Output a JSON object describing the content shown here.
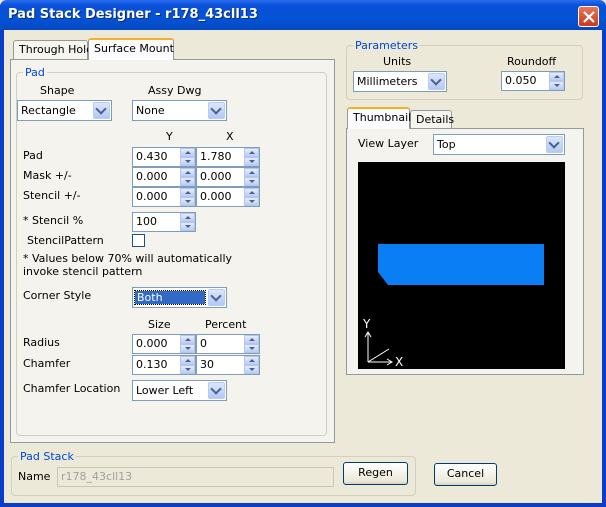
{
  "window": {
    "title": "Pad Stack Designer - r178_43cll13"
  },
  "tabs": [
    {
      "label": "Through Hole"
    },
    {
      "label": "Surface Mount"
    }
  ],
  "pad_group": {
    "legend": "Pad",
    "shape_label": "Shape",
    "shape_value": "Rectangle",
    "assy_label": "Assy Dwg",
    "assy_value": "None",
    "col_y": "Y",
    "col_x": "X",
    "rows": [
      {
        "label": "Pad",
        "y": "0.430",
        "x": "1.780"
      },
      {
        "label": "Mask +/-",
        "y": "0.000",
        "x": "0.000"
      },
      {
        "label": "Stencil +/-",
        "y": "0.000",
        "x": "0.000"
      }
    ],
    "stencil_pct_label": "* Stencil %",
    "stencil_pct_value": "100",
    "stencil_pattern_label": "StencilPattern",
    "note_line1": "* Values below 70% will automatically",
    "note_line2": "invoke stencil pattern",
    "corner_style_label": "Corner Style",
    "corner_style_value": "Both",
    "col_size": "Size",
    "col_percent": "Percent",
    "radius_label": "Radius",
    "radius_size": "0.000",
    "radius_percent": "0",
    "chamfer_label": "Chamfer",
    "chamfer_size": "0.130",
    "chamfer_percent": "30",
    "chamfer_loc_label": "Chamfer Location",
    "chamfer_loc_value": "Lower Left"
  },
  "parameters": {
    "legend": "Parameters",
    "units_label": "Units",
    "units_value": "Millimeters",
    "roundoff_label": "Roundoff",
    "roundoff_value": "0.050"
  },
  "preview_tabs": [
    {
      "label": "Thumbnail"
    },
    {
      "label": "Details"
    }
  ],
  "view_layer": {
    "label": "View Layer",
    "value": "Top"
  },
  "preview": {
    "axis_y": "Y",
    "axis_x": "X",
    "pad_color": "#0a7ef5",
    "bg_color": "#000000"
  },
  "pad_stack": {
    "legend": "Pad Stack",
    "name_label": "Name",
    "name_value": "r178_43cll13",
    "regen_label": "Regen",
    "cancel_label": "Cancel"
  }
}
